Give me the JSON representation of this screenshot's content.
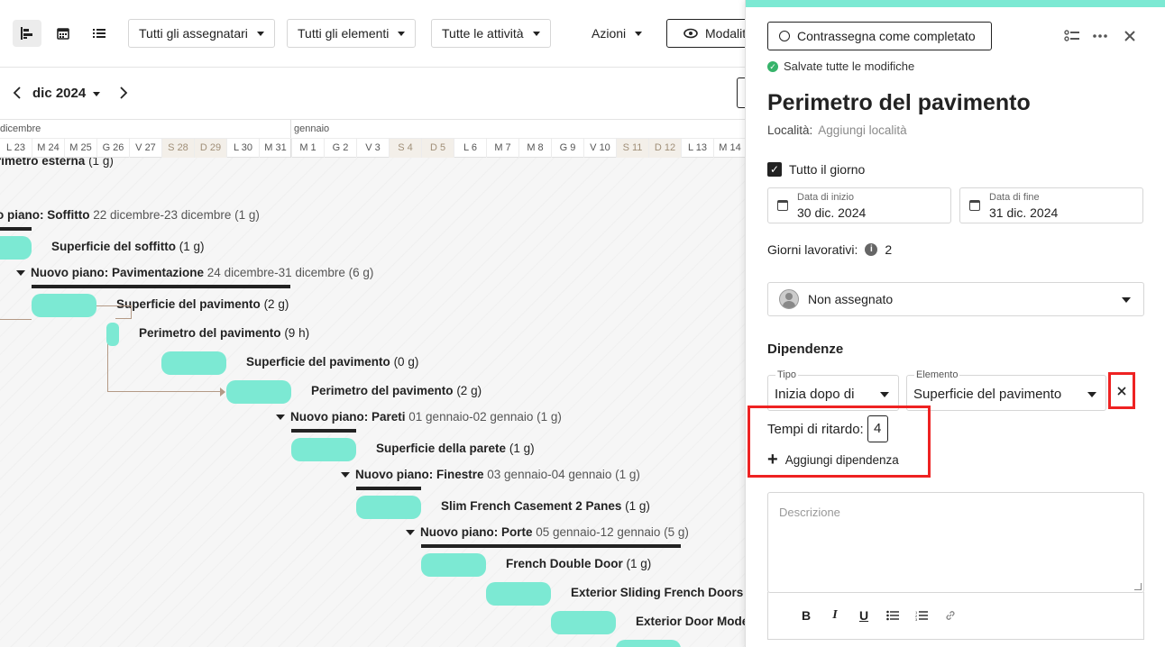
{
  "toolbar": {
    "assignees": "Tutti gli assegnatari",
    "elements": "Tutti gli elementi",
    "activities": "Tutte le attività",
    "actions": "Azioni",
    "mode": "Modalit"
  },
  "nav": {
    "month": "dic 2024"
  },
  "timeline": {
    "months": [
      "dicembre",
      "gennaio"
    ],
    "days": [
      {
        "label": "L 23",
        "weekend": false
      },
      {
        "label": "M 24",
        "weekend": false
      },
      {
        "label": "M 25",
        "weekend": false
      },
      {
        "label": "G 26",
        "weekend": false
      },
      {
        "label": "V 27",
        "weekend": false
      },
      {
        "label": "S 28",
        "weekend": true
      },
      {
        "label": "D 29",
        "weekend": true
      },
      {
        "label": "L 30",
        "weekend": false
      },
      {
        "label": "M 31",
        "weekend": false
      },
      {
        "label": "M 1",
        "weekend": false
      },
      {
        "label": "G 2",
        "weekend": false
      },
      {
        "label": "V 3",
        "weekend": false
      },
      {
        "label": "S 4",
        "weekend": true
      },
      {
        "label": "D 5",
        "weekend": true
      },
      {
        "label": "L 6",
        "weekend": false
      },
      {
        "label": "M 7",
        "weekend": false
      },
      {
        "label": "M 8",
        "weekend": false
      },
      {
        "label": "G 9",
        "weekend": false
      },
      {
        "label": "V 10",
        "weekend": false
      },
      {
        "label": "S 11",
        "weekend": true
      },
      {
        "label": "D 12",
        "weekend": true
      },
      {
        "label": "L 13",
        "weekend": false
      },
      {
        "label": "M 14",
        "weekend": false
      }
    ]
  },
  "gantt": {
    "r0": {
      "label": "rimetro esterna",
      "duration": "(1 g)"
    },
    "g1": {
      "label": "o piano: Soffitto",
      "dates": "22 dicembre-23 dicembre (1 g)"
    },
    "r2": {
      "label": "Superficie del soffitto",
      "duration": "(1 g)"
    },
    "g3": {
      "label": "Nuovo piano: Pavimentazione",
      "dates": "24 dicembre-31 dicembre (6 g)"
    },
    "r4": {
      "label": "Superficie del pavimento",
      "duration": "(2 g)"
    },
    "r5": {
      "label": "Perimetro del pavimento",
      "duration": "(9 h)"
    },
    "r6": {
      "label": "Superficie del pavimento",
      "duration": "(0 g)"
    },
    "r7": {
      "label": "Perimetro del pavimento",
      "duration": "(2 g)"
    },
    "g8": {
      "label": "Nuovo piano: Pareti",
      "dates": "01 gennaio-02 gennaio (1 g)"
    },
    "r9": {
      "label": "Superficie della parete",
      "duration": "(1 g)"
    },
    "g10": {
      "label": "Nuovo piano: Finestre",
      "dates": "03 gennaio-04 gennaio (1 g)"
    },
    "r11": {
      "label": "Slim French Casement 2 Panes",
      "duration": "(1 g)"
    },
    "g12": {
      "label": "Nuovo piano: Porte",
      "dates": "05 gennaio-12 gennaio (5 g)"
    },
    "r13": {
      "label": "French Double Door",
      "duration": "(1 g)"
    },
    "r14": {
      "label": "Exterior Sliding French Doors",
      "duration": "("
    },
    "r15": {
      "label": "Exterior Door Mode",
      "duration": ""
    }
  },
  "panel": {
    "complete_btn": "Contrassegna come completato",
    "saved": "Salvate tutte le modifiche",
    "title": "Perimetro del pavimento",
    "location_label": "Località:",
    "location_link": "Aggiungi località",
    "all_day": "Tutto il giorno",
    "start_label": "Data di inizio",
    "start_value": "30 dic. 2024",
    "end_label": "Data di fine",
    "end_value": "31 dic. 2024",
    "workdays_label": "Giorni lavorativi:",
    "workdays_value": "2",
    "assignee": "Non assegnato",
    "deps_title": "Dipendenze",
    "type_label": "Tipo",
    "type_value": "Inizia dopo di",
    "element_label": "Elemento",
    "element_value": "Superficie del pavimento",
    "delay_label": "Tempi di ritardo:",
    "delay_value": "4",
    "add_dep": "Aggiungi dipendenza",
    "desc_placeholder": "Descrizione"
  },
  "colors": {
    "accent": "#7ce9d3",
    "highlight": "#e22222"
  }
}
